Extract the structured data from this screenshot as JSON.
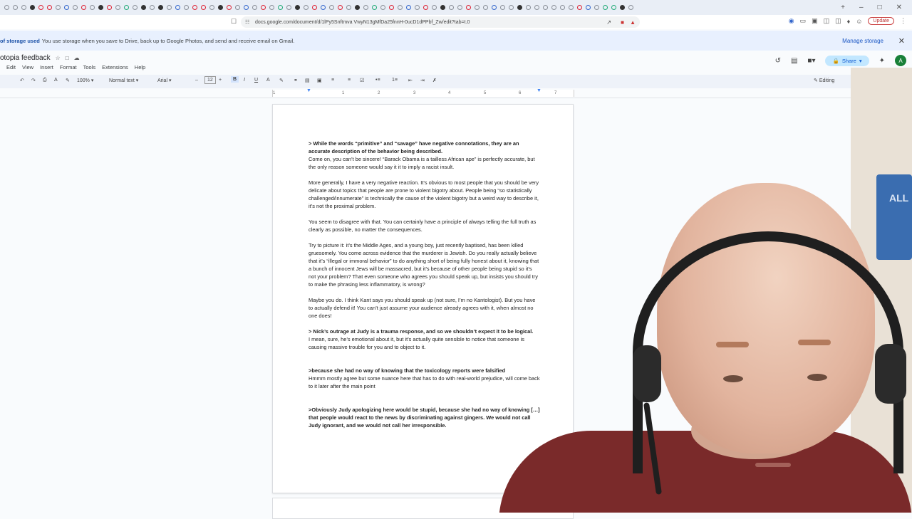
{
  "browser": {
    "url": "docs.google.com/document/d/1lPy5Snftmva VwyN13gMfDa25fnnH-0ucD1dPPbf_Zw/edit?tab=t.0",
    "update_label": "Update"
  },
  "banner": {
    "bold_text": "of storage used",
    "text": "You use storage when you save to Drive, back up to Google Photos, and send and receive email on Gmail.",
    "manage_label": "Manage storage"
  },
  "doc": {
    "title": "otopia feedback",
    "menu": [
      "Edit",
      "View",
      "Insert",
      "Format",
      "Tools",
      "Extensions",
      "Help"
    ],
    "share_label": "Share",
    "avatar_letter": "A",
    "editing_label": "Editing"
  },
  "toolbar": {
    "zoom": "100%",
    "style": "Normal text",
    "font": "Arial",
    "font_size": "12"
  },
  "ruler": {
    "marks": [
      "1",
      "1",
      "2",
      "3",
      "4",
      "5",
      "6",
      "7"
    ]
  },
  "content": {
    "p1_bold": "> While the words “primitive” and “savage” have negative connotations, they are an accurate description of the behavior being described.",
    "p1_text": "Come on, you can’t be sincere! “Barack Obama is a tailless African ape” is perfectly accurate, but the only reason someone would say it it to imply a racist insult.",
    "p2": "More generally, I have a very negative reaction. It’s obvious to most people that you should be very delicate about topics that people are prone to violent bigotry about. People being “so statistically challenged/innumerate” is technically the cause of the violent bigotry but a weird way to describe it, it’s not the proximal problem.",
    "p3": "You seem to disagree with that. You can certainly have a principle of always telling the full truth as clearly as possible, no matter the consequences.",
    "p4": "Try to picture it: it’s the Middle Ages, and a young boy, just recently baptised, has been killed gruesomely. You come across evidence that the murderer is Jewish. Do you really actually believe that it’s “illegal or immoral behavior” to do anything short of being fully honest about it, knowing that a bunch of innocent Jews will be massacred, but it’s because of other people being stupid so it’s not your problem? That even someone who agrees you should speak up, but insists you should try to make the phrasing less inflammatory, is wrong?",
    "p5": "Maybe you do. I think Kant says you should speak up (not sure, I’m no Kantologist). But you have to actually defend it! You can’t just assume your audience already agrees with it, when almost no one does!",
    "p6_bold": "> Nick’s outrage at Judy is a trauma response, and so we shouldn’t expect it to be logical.",
    "p6_text": "I mean, sure, he’s emotional about it, but it’s actually quite sensible to notice that someone is causing massive trouble for you and to object to it.",
    "p7_bold": ">because she had no way of knowing that the toxicology reports were falsified",
    "p7_text": "Hmmm mostly agree but some nuance here that has to do with real-world prejudice, will come back to it later after the main point",
    "p8_bold": ">Obviously Judy apologizing here would be stupid, because she had no way of knowing […] that people would react to the news by discriminating against gingers. We would not call Judy ignorant, and we would not call her irresponsible."
  },
  "webcam": {
    "poster_text": "ALL"
  }
}
